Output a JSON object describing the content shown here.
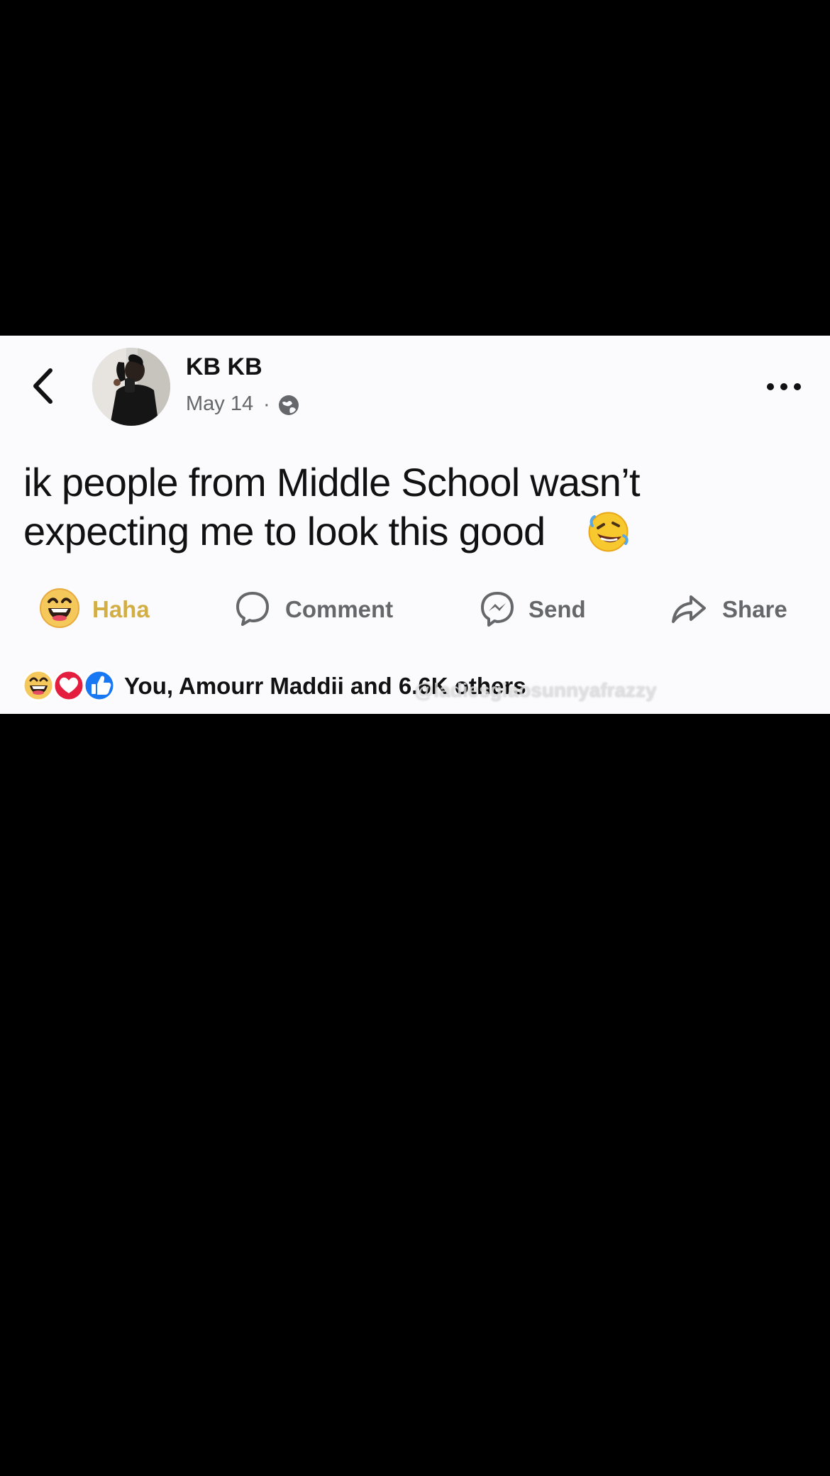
{
  "post": {
    "author": "KB KB",
    "date": "May 14",
    "date_separator": "·",
    "privacy_icon": "globe-icon",
    "text": "ik people from Middle School wasn’t expecting me to look this good",
    "emoji": "🤣"
  },
  "actions": {
    "haha_label": "Haha",
    "comment_label": "Comment",
    "send_label": "Send",
    "share_label": "Share",
    "haha_icon": "haha-reaction-icon",
    "comment_icon": "comment-icon",
    "send_icon": "messenger-icon",
    "share_icon": "share-icon"
  },
  "reactions": {
    "summary": "You, Amourr Maddii and 6.6K others",
    "icons": [
      "haha-reaction-icon",
      "love-reaction-icon",
      "like-reaction-icon"
    ]
  },
  "watermark": "@ladiesgiaosunnyafrazzy",
  "colors": {
    "background": "#000000",
    "post_background": "#fbfbfd",
    "primary_text": "#111111",
    "secondary_text": "#65676b",
    "haha_label": "#d3ae45",
    "like_blue": "#1877f2",
    "love_red": "#e41e3f"
  }
}
